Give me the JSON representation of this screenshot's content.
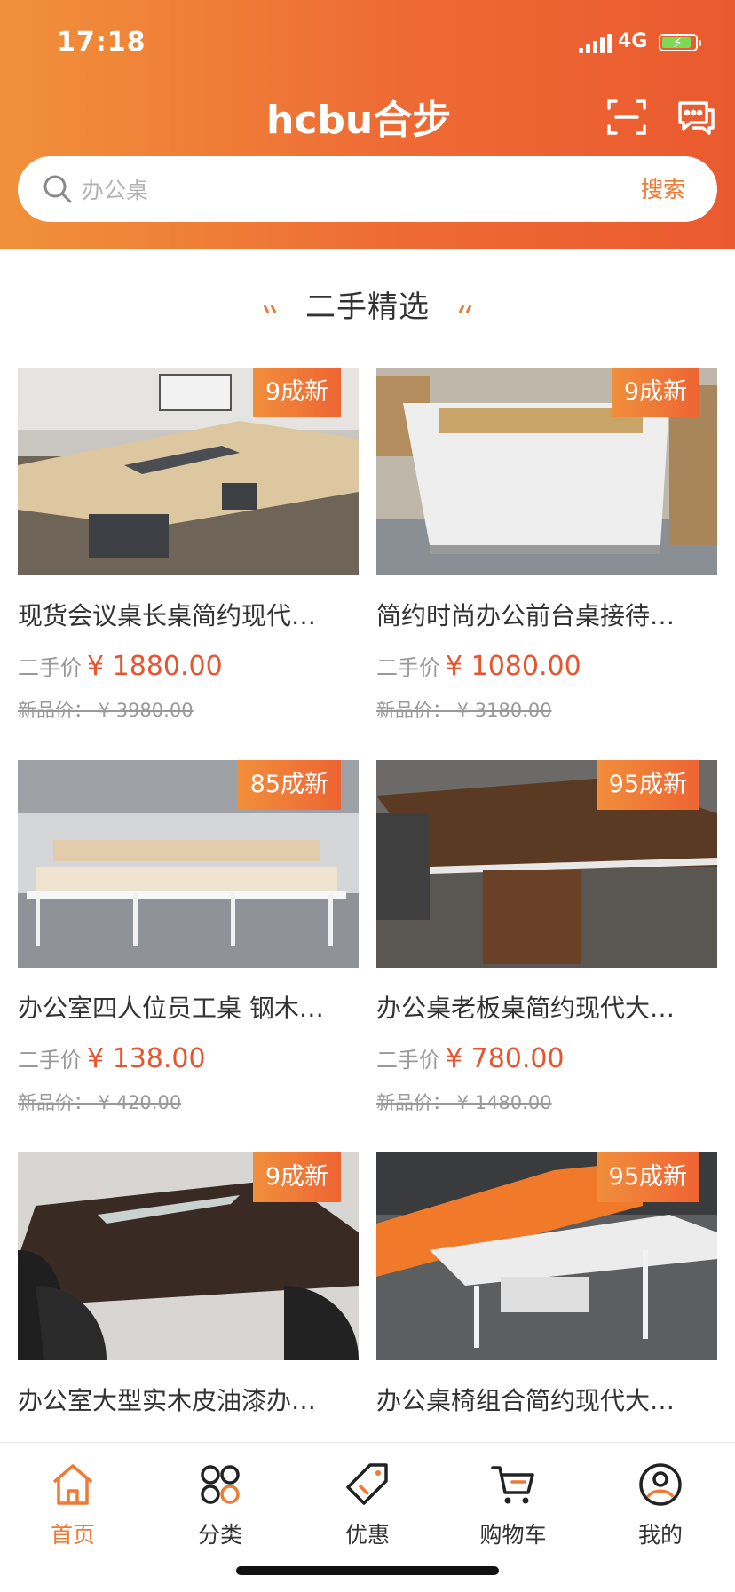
{
  "status": {
    "time": "17:18",
    "network": "4G"
  },
  "header": {
    "logo_text": "hcbu合步"
  },
  "search": {
    "placeholder": "办公桌",
    "button": "搜索"
  },
  "section": {
    "title": "二手精选"
  },
  "products": [
    {
      "badge": "9成新",
      "title": "现货会议桌长桌简约现代…",
      "price_label": "二手价",
      "price": "¥ 1880.00",
      "orig": "新品价： ¥ 3980.00"
    },
    {
      "badge": "9成新",
      "title": "简约时尚办公前台桌接待…",
      "price_label": "二手价",
      "price": "¥ 1080.00",
      "orig": "新品价： ¥ 3180.00"
    },
    {
      "badge": "85成新",
      "title": "办公室四人位员工桌 钢木…",
      "price_label": "二手价",
      "price": "¥ 138.00",
      "orig": "新品价： ¥ 420.00"
    },
    {
      "badge": "95成新",
      "title": "办公桌老板桌简约现代大…",
      "price_label": "二手价",
      "price": "¥ 780.00",
      "orig": "新品价： ¥ 1480.00"
    },
    {
      "badge": "9成新",
      "title": "办公室大型实木皮油漆办…"
    },
    {
      "badge": "95成新",
      "title": "办公桌椅组合简约现代大…"
    }
  ],
  "tabbar": [
    {
      "label": "首页",
      "icon": "home-icon",
      "active": true
    },
    {
      "label": "分类",
      "icon": "category-icon"
    },
    {
      "label": "优惠",
      "icon": "coupon-tag-icon"
    },
    {
      "label": "购物车",
      "icon": "cart-icon"
    },
    {
      "label": "我的",
      "icon": "user-icon"
    }
  ],
  "colors": {
    "accent": "#ee7a34",
    "price": "#e8542f",
    "header_start": "#f0913a",
    "header_end": "#ea5a2f"
  }
}
